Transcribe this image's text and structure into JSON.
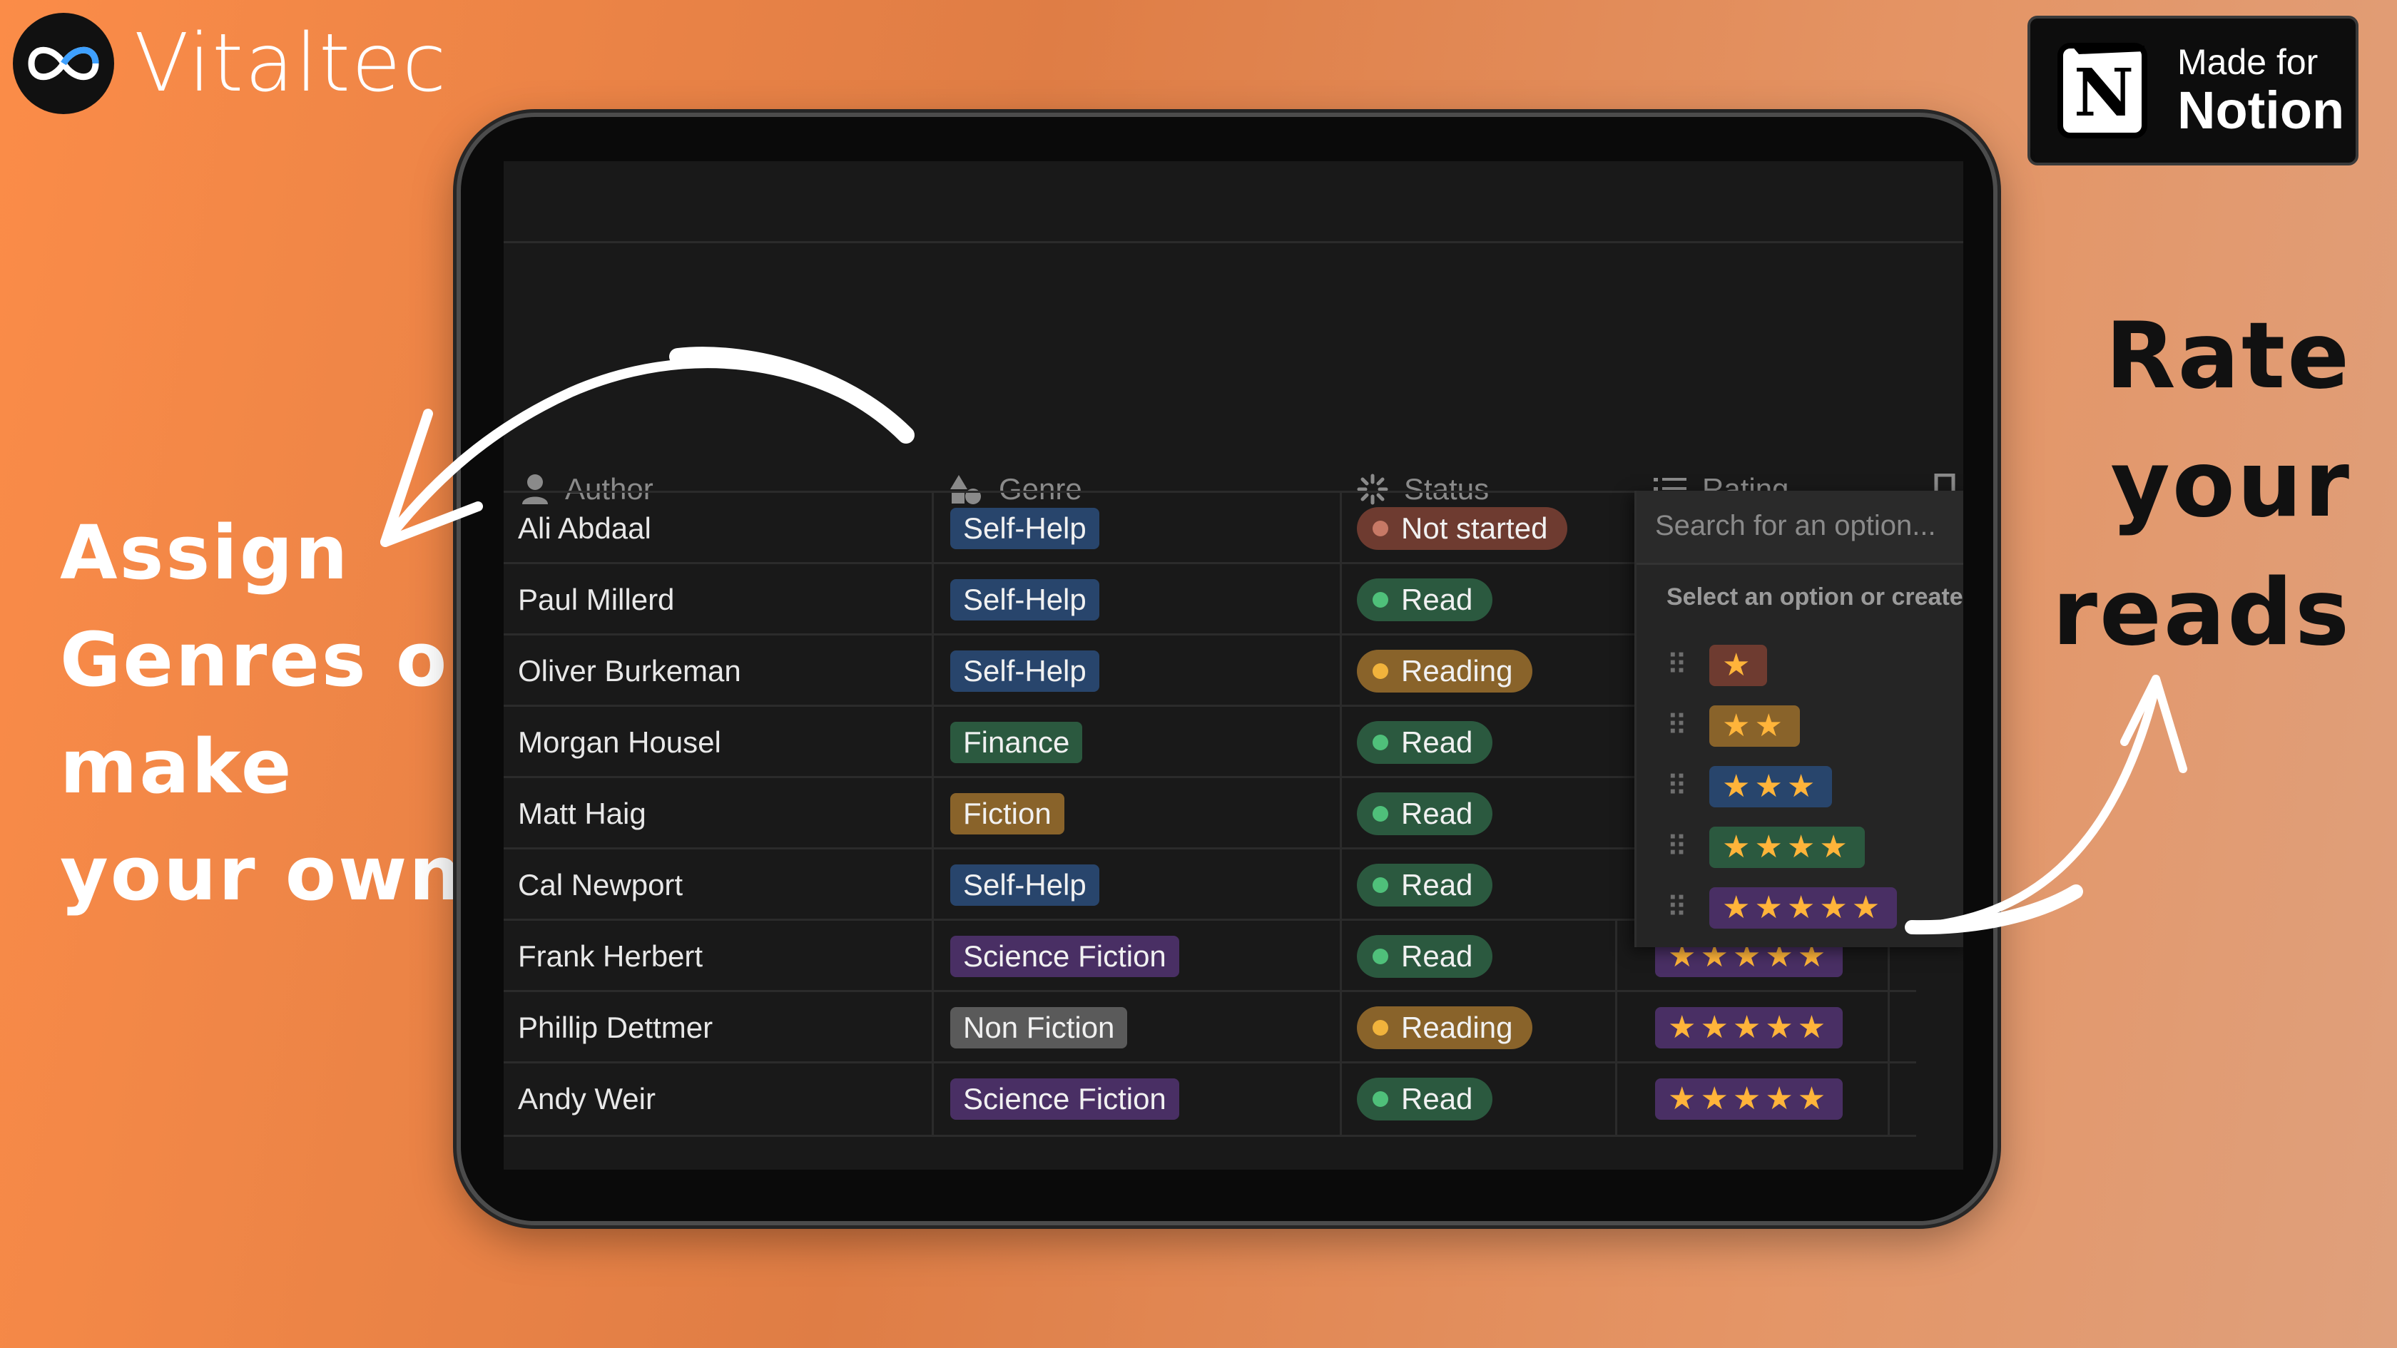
{
  "brand": {
    "name": "Vitaltec"
  },
  "badge": {
    "line1": "Made for",
    "line2": "Notion"
  },
  "callouts": {
    "left": [
      "Assign",
      "Genres or",
      "make",
      "your own"
    ],
    "right": [
      "Rate",
      "your",
      "reads"
    ]
  },
  "table": {
    "columns": {
      "author": "Author",
      "genre": "Genre",
      "status": "Status",
      "rating": "Rating"
    },
    "rows": [
      {
        "author": "Ali Abdaal",
        "genre": "Self-Help",
        "status": "Not started",
        "rating": ""
      },
      {
        "author": "Paul Millerd",
        "genre": "Self-Help",
        "status": "Read",
        "rating": ""
      },
      {
        "author": "Oliver Burkeman",
        "genre": "Self-Help",
        "status": "Reading",
        "rating": ""
      },
      {
        "author": "Morgan Housel",
        "genre": "Finance",
        "status": "Read",
        "rating": ""
      },
      {
        "author": "Matt Haig",
        "genre": "Fiction",
        "status": "Read",
        "rating": ""
      },
      {
        "author": "Cal Newport",
        "genre": "Self-Help",
        "status": "Read",
        "rating": ""
      },
      {
        "author": "Frank Herbert",
        "genre": "Science Fiction",
        "status": "Read",
        "rating": "★★★★★"
      },
      {
        "author": "Phillip Dettmer",
        "genre": "Non Fiction",
        "status": "Reading",
        "rating": "★★★★★"
      },
      {
        "author": "Andy Weir",
        "genre": "Science Fiction",
        "status": "Read",
        "rating": "★★★★★"
      }
    ]
  },
  "dropdown": {
    "placeholder": "Search for an option...",
    "hint": "Select an option or create",
    "options": [
      "★",
      "★★",
      "★★★",
      "★★★★",
      "★★★★★"
    ]
  },
  "colors": {
    "selfhelp": "#28456c",
    "finance": "#2b593f",
    "fiction": "#89632a",
    "scifi": "#492f64",
    "nonfiction": "#5a5a5a",
    "status_notstarted": "#6e3b30",
    "status_read": "#2b593f",
    "status_reading": "#89632a"
  }
}
